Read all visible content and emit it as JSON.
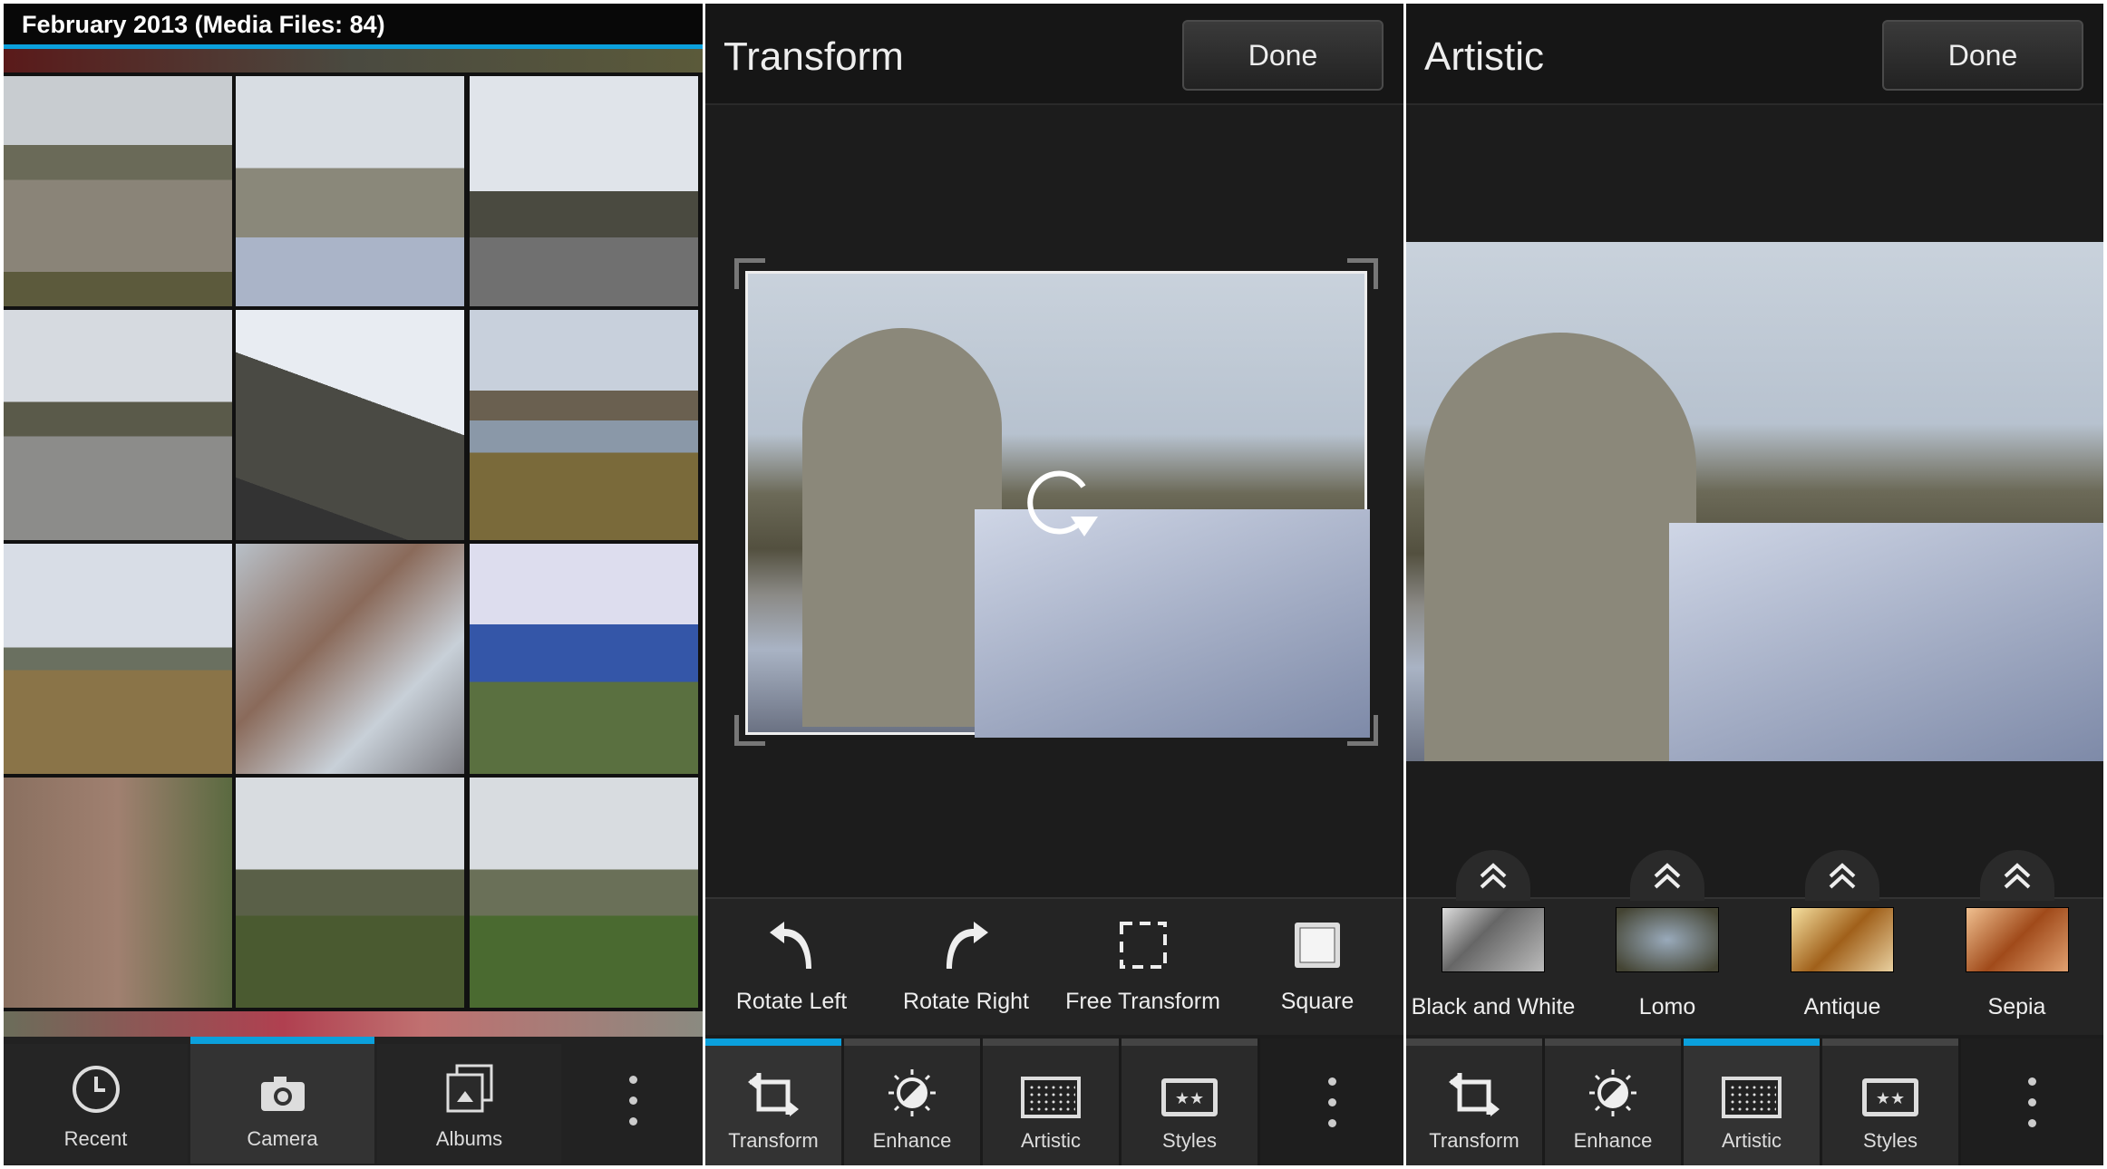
{
  "gallery": {
    "title": "February 2013 (Media Files: 84)",
    "accent": "#0ba0dc",
    "tabs": [
      {
        "label": "Recent",
        "icon": "clock-icon",
        "active": false
      },
      {
        "label": "Camera",
        "icon": "camera-icon",
        "active": true
      },
      {
        "label": "Albums",
        "icon": "albums-icon",
        "active": false
      }
    ]
  },
  "transform": {
    "title": "Transform",
    "done_label": "Done",
    "tools": [
      {
        "label": "Rotate Left",
        "icon": "rotate-left-icon"
      },
      {
        "label": "Rotate Right",
        "icon": "rotate-right-icon"
      },
      {
        "label": "Free Transform",
        "icon": "free-transform-icon"
      },
      {
        "label": "Square",
        "icon": "square-icon"
      }
    ]
  },
  "artistic": {
    "title": "Artistic",
    "done_label": "Done",
    "filters": [
      {
        "label": "Black and White",
        "icon": "expand-up-icon"
      },
      {
        "label": "Lomo",
        "icon": "expand-up-icon"
      },
      {
        "label": "Antique",
        "icon": "expand-up-icon"
      },
      {
        "label": "Sepia",
        "icon": "expand-up-icon"
      }
    ]
  },
  "editor_tabs": [
    {
      "label": "Transform",
      "icon": "transform-icon"
    },
    {
      "label": "Enhance",
      "icon": "enhance-icon"
    },
    {
      "label": "Artistic",
      "icon": "artistic-icon"
    },
    {
      "label": "Styles",
      "icon": "styles-icon"
    }
  ],
  "active_editor_tab": {
    "transform_panel": "Transform",
    "artistic_panel": "Artistic"
  }
}
